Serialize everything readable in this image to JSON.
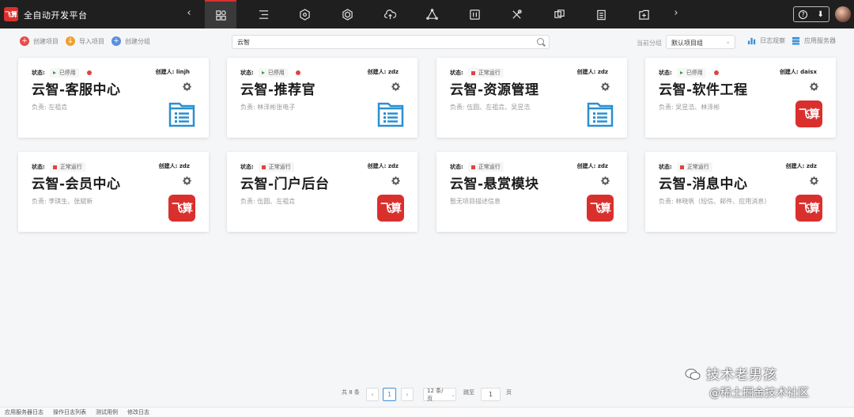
{
  "app": {
    "logo_text": "飞算",
    "title": "全自动开发平台"
  },
  "nav": {
    "prev": "‹",
    "next": "›",
    "icons": [
      "dashboard-icon",
      "list-icon",
      "hexagon-icon",
      "gear-hex-icon",
      "cloud-upload-icon",
      "network-icon",
      "sliders-icon",
      "tools-icon",
      "copy-icon",
      "clipboard-icon",
      "plus-folder-icon"
    ],
    "help": "?",
    "download": "⬇"
  },
  "toolbar": {
    "create_project": "创建项目",
    "import_project": "导入项目",
    "create_group": "创建分组",
    "search_value": "云智",
    "group_label": "当前分组",
    "group_value": "默认项目组",
    "log_monitor": "日志观察",
    "app_server": "应用服务器"
  },
  "cards": [
    {
      "status_label": "状态:",
      "status": "已停用",
      "status_type": "stopped",
      "warning": true,
      "creator": "创建人: linjh",
      "title": "云智-客服中心",
      "desc": "负责: 左祖垚",
      "icon": "document-folder-icon"
    },
    {
      "status_label": "状态:",
      "status": "已停用",
      "status_type": "stopped",
      "warning": true,
      "creator": "创建人: zdz",
      "title": "云智-推荐官",
      "desc": "负责: 林泽彬张电子",
      "icon": "document-folder-icon"
    },
    {
      "status_label": "状态:",
      "status": "正常运行",
      "status_type": "running",
      "warning": false,
      "creator": "创建人: zdz",
      "title": "云智-资源管理",
      "desc": "负责: 伍圆、左祖垚、吴昱浩",
      "icon": "document-folder-icon"
    },
    {
      "status_label": "状态:",
      "status": "已停用",
      "status_type": "stopped",
      "warning": true,
      "creator": "创建人: daisx",
      "title": "云智-软件工程",
      "desc": "负责: 吴昱浩、林泽彬",
      "icon": "feisuan-logo"
    },
    {
      "status_label": "状态:",
      "status": "正常运行",
      "status_type": "running",
      "warning": false,
      "creator": "创建人: zdz",
      "title": "云智-会员中心",
      "desc": "负责: 李琪生、张斌新",
      "icon": "feisuan-logo"
    },
    {
      "status_label": "状态:",
      "status": "正常运行",
      "status_type": "running",
      "warning": false,
      "creator": "创建人: zdz",
      "title": "云智-门户后台",
      "desc": "负责: 伍圆、左祖垚",
      "icon": "feisuan-logo"
    },
    {
      "status_label": "状态:",
      "status": "正常运行",
      "status_type": "running",
      "warning": false,
      "creator": "创建人: zdz",
      "title": "云智-悬赏模块",
      "desc": "暂无项目描述信息",
      "icon": "feisuan-logo"
    },
    {
      "status_label": "状态:",
      "status": "正常运行",
      "status_type": "running",
      "warning": false,
      "creator": "创建人: zdz",
      "title": "云智-消息中心",
      "desc": "负责: 林晓帆（短信、邮件、应用消息）",
      "icon": "feisuan-logo"
    }
  ],
  "pagination": {
    "total": "共 8 条",
    "prev": "‹",
    "current": "1",
    "next": "›",
    "page_size": "12 条/页",
    "goto_label": "跳至",
    "goto_value": "1",
    "page_suffix": "页"
  },
  "footer": [
    "应用服务器日志",
    "操作日志列表",
    "测试用例",
    "修改日志"
  ],
  "watermark": {
    "line1": "技术老男孩",
    "line2": "@稀土掘金技术社区"
  },
  "colors": {
    "topbar": "#1f1f1f",
    "brand_red": "#d9302e",
    "link_blue": "#3d8fd6",
    "folder_blue": "#2b8fd1",
    "running": "#e04343",
    "stopped": "#2aa33c"
  }
}
